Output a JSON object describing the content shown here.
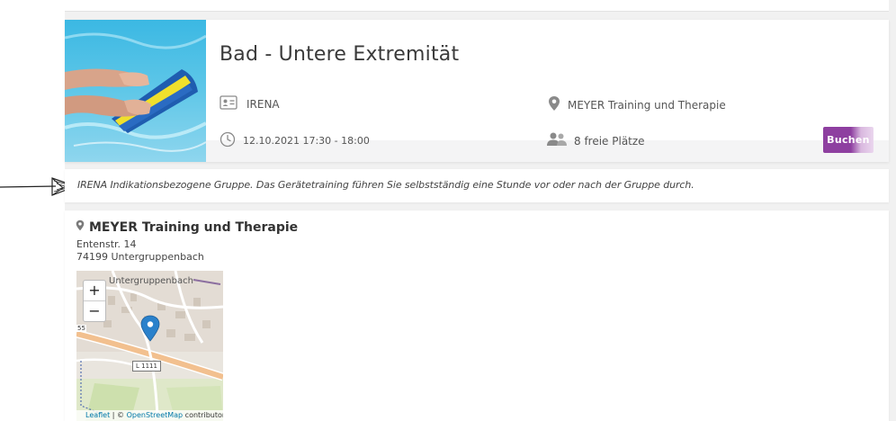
{
  "course": {
    "title": "Bad - Untere Extremität",
    "program": "IRENA",
    "location": "MEYER Training und Therapie",
    "datetime": "12.10.2021 17:30 - 18:00",
    "spots": "8 freie Plätze",
    "book_label": "Buchen"
  },
  "description": "IRENA Indikationsbezogene Gruppe. Das Gerätetraining führen Sie selbstständig eine Stunde vor oder nach der Gruppe durch.",
  "location_card": {
    "name": "MEYER Training und Therapie",
    "street": "Entenstr. 14",
    "city": "74199 Untergruppenbach",
    "map": {
      "zoom_in": "+",
      "zoom_out": "−",
      "town_label": "Untergruppenbach",
      "road_label": "L 1111",
      "road_number": "55",
      "attribution_leaflet": "Leaflet",
      "attribution_sep": " | © ",
      "attribution_osm": "OpenStreetMap",
      "attribution_tail": " contributors"
    }
  },
  "colors": {
    "accent": "#8e3fa0",
    "pin": "#2a81cb"
  },
  "icons": {
    "program": "id-card-icon",
    "location": "map-pin-icon",
    "time": "clock-icon",
    "spots": "users-icon"
  }
}
